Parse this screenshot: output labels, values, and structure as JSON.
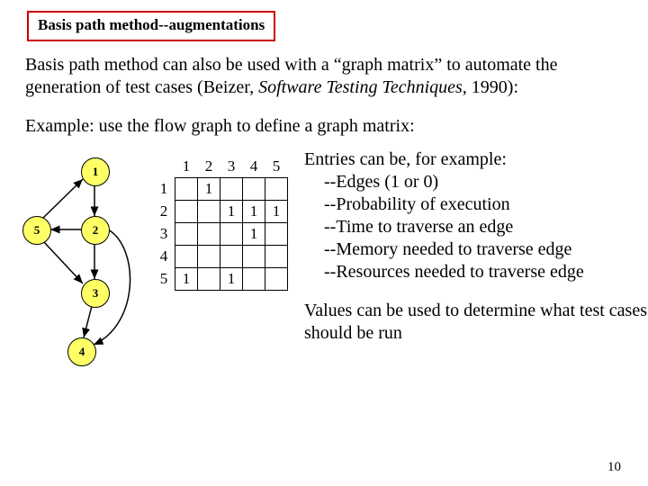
{
  "title": "Basis path method--augmentations",
  "para1": "Basis path method can also be used with a “graph matrix” to automate the generation of test cases (Beizer, ",
  "para1_italic": "Software Testing Techniques",
  "para1_tail": ", 1990):",
  "example": "Example:  use the flow graph to define a graph matrix:",
  "nodes": {
    "n1": "1",
    "n2": "2",
    "n3": "3",
    "n4": "4",
    "n5": "5"
  },
  "matrix": {
    "col_headers": [
      "1",
      "2",
      "3",
      "4",
      "5"
    ],
    "row_headers": [
      "1",
      "2",
      "3",
      "4",
      "5"
    ],
    "cells": [
      [
        "",
        "1",
        "",
        "",
        ""
      ],
      [
        "",
        "",
        "1",
        "1",
        "1"
      ],
      [
        "",
        "",
        "",
        "1",
        ""
      ],
      [
        "",
        "",
        "",
        "",
        ""
      ],
      [
        "1",
        "",
        "1",
        "",
        ""
      ]
    ]
  },
  "entries_intro": "Entries can be, for example:",
  "entries": [
    "--Edges (1 or 0)",
    "--Probability of execution",
    "--Time to traverse an edge",
    "--Memory needed to traverse edge",
    "--Resources needed to traverse edge"
  ],
  "values_text": "Values can be used to determine what test cases should be run",
  "page_number": "10",
  "chart_data": {
    "type": "table",
    "title": "Graph matrix for flow graph",
    "categories": [
      "1",
      "2",
      "3",
      "4",
      "5"
    ],
    "series": [
      {
        "name": "1",
        "values": [
          null,
          1,
          null,
          null,
          null
        ]
      },
      {
        "name": "2",
        "values": [
          null,
          null,
          1,
          1,
          1
        ]
      },
      {
        "name": "3",
        "values": [
          null,
          null,
          null,
          1,
          null
        ]
      },
      {
        "name": "4",
        "values": [
          null,
          null,
          null,
          null,
          null
        ]
      },
      {
        "name": "5",
        "values": [
          1,
          null,
          1,
          null,
          null
        ]
      }
    ],
    "graph_edges": [
      [
        1,
        2
      ],
      [
        2,
        3
      ],
      [
        2,
        4
      ],
      [
        2,
        5
      ],
      [
        3,
        4
      ],
      [
        5,
        1
      ],
      [
        5,
        3
      ]
    ]
  }
}
